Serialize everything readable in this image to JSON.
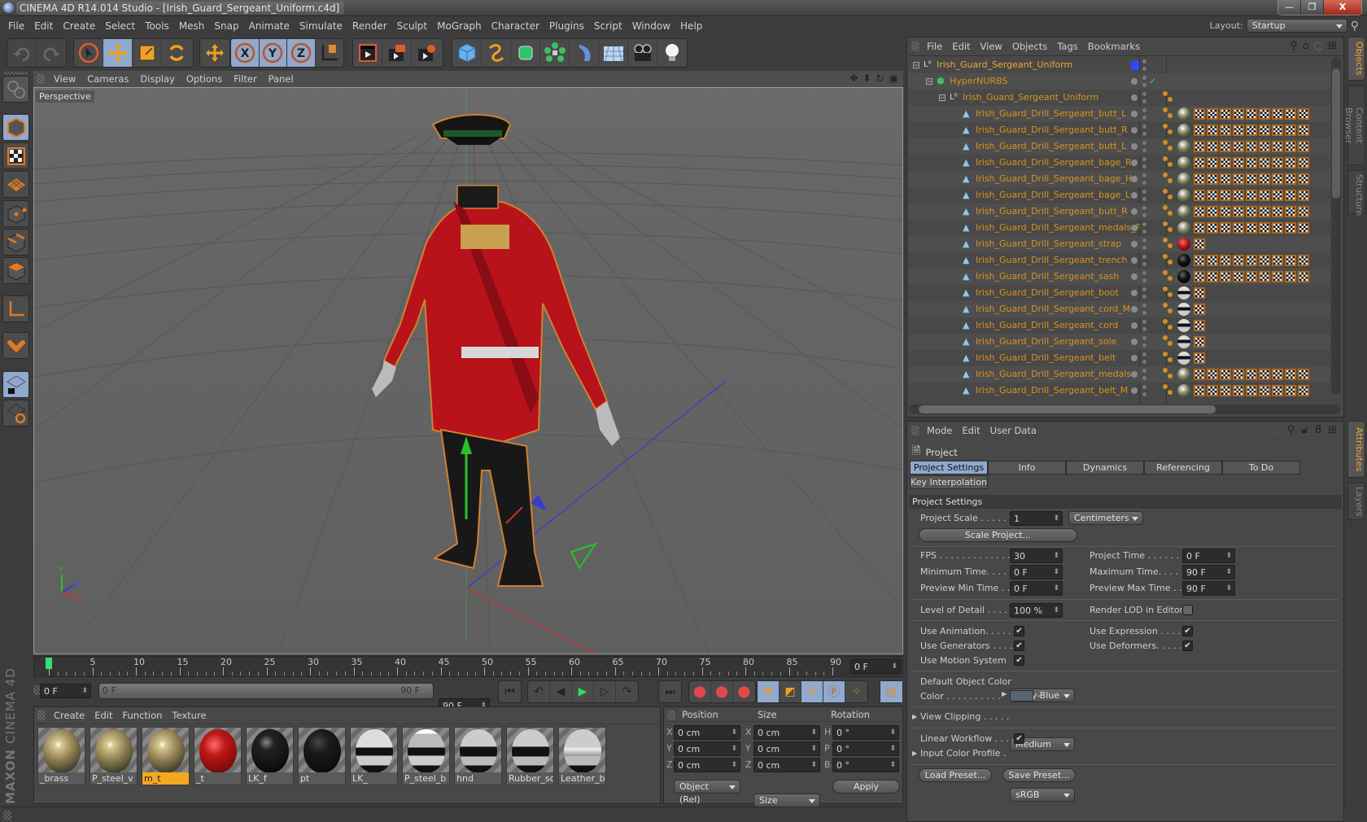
{
  "window": {
    "title": "CINEMA 4D R14.014 Studio - [Irish_Guard_Sergeant_Uniform.c4d]",
    "controls": {
      "minimize": "—",
      "maximize": "❐",
      "close": "X"
    }
  },
  "menubar": {
    "items": [
      "File",
      "Edit",
      "Create",
      "Select",
      "Tools",
      "Mesh",
      "Snap",
      "Animate",
      "Simulate",
      "Render",
      "Sculpt",
      "MoGraph",
      "Character",
      "Plugins",
      "Script",
      "Window",
      "Help"
    ],
    "layout_label": "Layout:",
    "layout_value": "Startup"
  },
  "toolbar": {
    "groups": [
      [
        "undo-icon",
        "redo-icon"
      ],
      [
        "live-selection-icon",
        "move-icon",
        "scale-icon",
        "rotate-icon"
      ],
      [
        "last-tool-icon"
      ],
      [
        "x-axis-lock-icon",
        "y-axis-lock-icon",
        "z-axis-lock-icon",
        "coordinate-system-icon"
      ],
      [
        "render-view-icon",
        "render-to-picture-viewer-icon",
        "render-settings-icon"
      ],
      [
        "cube-icon",
        "spline-pen-icon",
        "nurbs-icon",
        "array-icon",
        "deformer-icon",
        "floor-icon",
        "camera-icon",
        "light-icon"
      ]
    ]
  },
  "left_tools": [
    "make-editable-icon",
    "model-mode-icon",
    "texture-mode-icon",
    "workplane-icon",
    "points-mode-icon",
    "edges-mode-icon",
    "polygons-mode-icon",
    "axis-mode-icon",
    "magnet-icon",
    "workplane-lock-icon",
    "workplane-snap-icon"
  ],
  "viewport": {
    "menu": [
      "View",
      "Cameras",
      "Display",
      "Options",
      "Filter",
      "Panel"
    ],
    "camera_label": "Perspective",
    "axis_labels": {
      "x": "X",
      "y": "Y",
      "z": "Z"
    }
  },
  "timeline": {
    "ticks": [
      "0",
      "5",
      "10",
      "15",
      "20",
      "25",
      "30",
      "35",
      "40",
      "45",
      "50",
      "55",
      "60",
      "65",
      "70",
      "75",
      "80",
      "85",
      "90"
    ],
    "current_frame_field": "0 F",
    "start_field": "0 F",
    "range_start": "0 F",
    "range_end": "90 F",
    "end_field": "90 F",
    "current_frame_fraction": 0.0
  },
  "material_manager": {
    "menu": [
      "Create",
      "Edit",
      "Function",
      "Texture"
    ],
    "materials": [
      {
        "name": "_brass",
        "selected": false
      },
      {
        "name": "P_steel_v",
        "selected": false
      },
      {
        "name": "m_t",
        "selected": true
      },
      {
        "name": "_t",
        "selected": false
      },
      {
        "name": "LK_f",
        "selected": false
      },
      {
        "name": "pt",
        "selected": false
      },
      {
        "name": "LK_",
        "selected": false
      },
      {
        "name": "P_steel_b",
        "selected": false
      },
      {
        "name": "hnd",
        "selected": false
      },
      {
        "name": "Rubber_so",
        "selected": false
      },
      {
        "name": "Leather_bo",
        "selected": false
      }
    ]
  },
  "coordinates": {
    "headers": {
      "position": "Position",
      "size": "Size",
      "rotation": "Rotation"
    },
    "rows": [
      {
        "pos_axis": "X",
        "pos": "0 cm",
        "size_axis": "X",
        "size": "0 cm",
        "rot_axis": "H",
        "rot": "0 °"
      },
      {
        "pos_axis": "Y",
        "pos": "0 cm",
        "size_axis": "Y",
        "size": "0 cm",
        "rot_axis": "P",
        "rot": "0 °"
      },
      {
        "pos_axis": "Z",
        "pos": "0 cm",
        "size_axis": "Z",
        "size": "0 cm",
        "rot_axis": "B",
        "rot": "0 °"
      }
    ],
    "mode_dropdown": "Object (Rel)",
    "size_dropdown": "Size",
    "apply_label": "Apply"
  },
  "branding": {
    "maxon": "MAXON",
    "product": "CINEMA 4D"
  },
  "object_manager": {
    "menu": [
      "File",
      "Edit",
      "View",
      "Objects",
      "Tags",
      "Bookmarks"
    ],
    "objects": [
      {
        "name": "Irish_Guard_Sergeant_Uniform",
        "level": 0,
        "type": "null",
        "tags": 0
      },
      {
        "name": "HyperNURBS",
        "level": 1,
        "type": "hypernurbs",
        "tags": 0
      },
      {
        "name": "Irish_Guard_Sergeant_Uniform",
        "level": 2,
        "type": "null",
        "tags": 0
      },
      {
        "name": "Irish_Guard_Drill_Sergeant_butt_L",
        "level": 3,
        "type": "poly",
        "mat": "medal",
        "tags": 9
      },
      {
        "name": "Irish_Guard_Drill_Sergeant_butt_R",
        "level": 3,
        "type": "poly",
        "mat": "medal",
        "tags": 9
      },
      {
        "name": "Irish_Guard_Drill_Sergeant_butt_L",
        "level": 3,
        "type": "poly",
        "mat": "medal",
        "tags": 9
      },
      {
        "name": "Irish_Guard_Drill_Sergeant_bage_R",
        "level": 3,
        "type": "poly",
        "mat": "medal",
        "tags": 9
      },
      {
        "name": "Irish_Guard_Drill_Sergeant_bage_H",
        "level": 3,
        "type": "poly",
        "mat": "medal",
        "tags": 9
      },
      {
        "name": "Irish_Guard_Drill_Sergeant_bage_L",
        "level": 3,
        "type": "poly",
        "mat": "medal",
        "tags": 9
      },
      {
        "name": "Irish_Guard_Drill_Sergeant_butt_R",
        "level": 3,
        "type": "poly",
        "mat": "medal",
        "tags": 9
      },
      {
        "name": "Irish_Guard_Drill_Sergeant_medals_F",
        "level": 3,
        "type": "poly",
        "mat": "medal",
        "tags": 9
      },
      {
        "name": "Irish_Guard_Drill_Sergeant_strap",
        "level": 3,
        "type": "poly",
        "mat": "red",
        "tags": 1
      },
      {
        "name": "Irish_Guard_Drill_Sergeant_trench",
        "level": 3,
        "type": "poly",
        "mat": "black",
        "tags": 9
      },
      {
        "name": "Irish_Guard_Drill_Sergeant_sash",
        "level": 3,
        "type": "poly",
        "mat": "black",
        "tags": 9
      },
      {
        "name": "Irish_Guard_Drill_Sergeant_boot",
        "level": 3,
        "type": "poly",
        "mat": "stripe",
        "tags": 1
      },
      {
        "name": "Irish_Guard_Drill_Sergeant_cord_M",
        "level": 3,
        "type": "poly",
        "mat": "stripe",
        "tags": 1
      },
      {
        "name": "Irish_Guard_Drill_Sergeant_cord",
        "level": 3,
        "type": "poly",
        "mat": "stripe",
        "tags": 1
      },
      {
        "name": "Irish_Guard_Drill_Sergeant_sole",
        "level": 3,
        "type": "poly",
        "mat": "stripe",
        "tags": 1
      },
      {
        "name": "Irish_Guard_Drill_Sergeant_belt",
        "level": 3,
        "type": "poly",
        "mat": "stripe",
        "tags": 1
      },
      {
        "name": "Irish_Guard_Drill_Sergeant_medals",
        "level": 3,
        "type": "poly",
        "mat": "medal",
        "tags": 9
      },
      {
        "name": "Irish_Guard_Drill_Sergeant_belt_M",
        "level": 3,
        "type": "poly",
        "mat": "medal",
        "tags": 9
      }
    ]
  },
  "attributes": {
    "menu": [
      "Mode",
      "Edit",
      "User Data"
    ],
    "object_title": "Project",
    "tabs": [
      {
        "label": "Project Settings",
        "active": true
      },
      {
        "label": "Info",
        "active": false
      },
      {
        "label": "Dynamics",
        "active": false
      },
      {
        "label": "Referencing",
        "active": false
      },
      {
        "label": "To Do",
        "active": false
      },
      {
        "label": "Key Interpolation",
        "active": false
      }
    ],
    "section_title": "Project Settings",
    "project_scale_label": "Project Scale . . . . . .",
    "project_scale_value": "1",
    "project_scale_unit": "Centimeters",
    "scale_project_button": "Scale Project...",
    "fps_label": "FPS . . . . . . . . . . . . .",
    "fps_value": "30",
    "project_time_label": "Project Time . . . . . . . .",
    "project_time_value": "0 F",
    "min_time_label": "Minimum Time. . . . .",
    "min_time_value": "0 F",
    "max_time_label": "Maximum Time. . . . . .",
    "max_time_value": "90 F",
    "preview_min_label": "Preview Min Time . .",
    "preview_min_value": "0 F",
    "preview_max_label": "Preview Max Time . . .",
    "preview_max_value": "90 F",
    "lod_label": "Level of Detail . . . . .",
    "lod_value": "100 %",
    "render_lod_label": "Render LOD in Editor",
    "render_lod_checked": false,
    "use_animation_label": "Use Animation. . . . .",
    "use_animation": true,
    "use_expression_label": "Use Expression . . . . .",
    "use_expression": true,
    "use_generators_label": "Use Generators . . . .",
    "use_generators": true,
    "use_deformers_label": "Use Deformers. . . . . .",
    "use_deformers": true,
    "use_motion_label": "Use Motion System",
    "use_motion": true,
    "default_color_label": "Default Object Color",
    "default_color_value": "Gray-Blue",
    "color_label": "Color . . . . . . . . . .",
    "color_swatch": "#5a6470",
    "view_clipping_label": "View Clipping . . . . .",
    "view_clipping_value": "Medium",
    "linear_workflow_label": "Linear Workflow . . .",
    "linear_workflow": true,
    "input_color_label": "Input Color Profile .",
    "input_color_value": "sRGB",
    "load_preset": "Load Preset...",
    "save_preset": "Save Preset..."
  },
  "side_tabs": {
    "top": [
      {
        "label": "Objects",
        "active": true
      },
      {
        "label": "Content Browser",
        "active": false
      },
      {
        "label": "Structure",
        "active": false
      }
    ],
    "bottom": [
      {
        "label": "Attributes",
        "active": true
      },
      {
        "label": "Layers",
        "active": false
      }
    ]
  },
  "colors": {
    "accent_orange": "#f0a830",
    "selected_blue": "#8fa9cf",
    "object_name": "#d7941c"
  }
}
